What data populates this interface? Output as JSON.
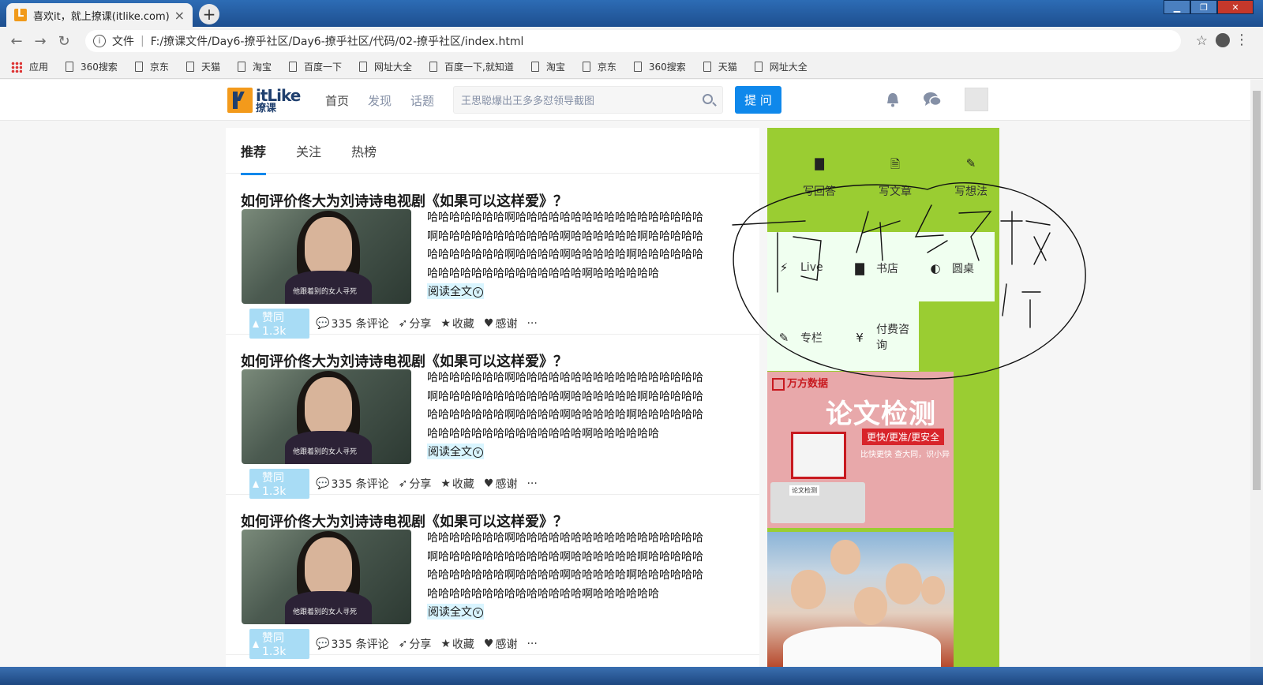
{
  "browser": {
    "tab_title": "喜欢it，就上撩课(itlike.com)",
    "tab_close": "×",
    "new_tab": "+",
    "url_scheme_label": "文件",
    "url": "F:/撩课文件/Day6-撩乎社区/Day6-撩乎社区/代码/02-撩乎社区/index.html",
    "bookmarks": [
      "应用",
      "360搜索",
      "京东",
      "天猫",
      "淘宝",
      "百度一下",
      "网址大全",
      "百度一下,就知道",
      "淘宝",
      "京东",
      "360搜索",
      "天猫",
      "网址大全"
    ]
  },
  "header": {
    "logo_text": "itLike",
    "logo_subtext": "撩课",
    "nav": [
      "首页",
      "发现",
      "话题"
    ],
    "search_placeholder": "王思聪爆出王多多怼领导截图",
    "ask_button": "提 问"
  },
  "feed": {
    "tabs": [
      "推荐",
      "关注",
      "热榜"
    ],
    "items": [
      {
        "title": "如何评价佟大为刘诗诗电视剧《如果可以这样爱》？",
        "excerpt": "哈哈哈哈哈哈哈啊哈哈哈哈哈哈哈哈哈哈哈哈哈哈哈哈哈啊哈哈哈哈哈哈哈哈哈哈哈啊哈哈哈哈哈哈啊哈哈哈哈哈哈哈哈哈哈哈哈啊哈哈哈哈啊哈哈哈哈哈啊哈哈哈哈哈哈哈哈哈哈哈哈哈哈哈哈哈哈哈哈啊哈哈哈哈哈哈",
        "thumb_caption": "他跟着别的女人寻死",
        "read_more": "阅读全文",
        "vote": "赞同 1.3k",
        "comments": "335 条评论",
        "share": "分享",
        "collect": "收藏",
        "thanks": "感谢",
        "more": "···"
      },
      {
        "title": "如何评价佟大为刘诗诗电视剧《如果可以这样爱》？",
        "excerpt": "哈哈哈哈哈哈哈啊哈哈哈哈哈哈哈哈哈哈哈哈哈哈哈哈哈啊哈哈哈哈哈哈哈哈哈哈哈啊哈哈哈哈哈哈啊哈哈哈哈哈哈哈哈哈哈哈哈啊哈哈哈哈啊哈哈哈哈哈啊哈哈哈哈哈哈哈哈哈哈哈哈哈哈哈哈哈哈哈哈啊哈哈哈哈哈哈",
        "thumb_caption": "他跟着别的女人寻死",
        "read_more": "阅读全文",
        "vote": "赞同 1.3k",
        "comments": "335 条评论",
        "share": "分享",
        "collect": "收藏",
        "thanks": "感谢",
        "more": "···"
      },
      {
        "title": "如何评价佟大为刘诗诗电视剧《如果可以这样爱》？",
        "excerpt": "哈哈哈哈哈哈哈啊哈哈哈哈哈哈哈哈哈哈哈哈哈哈哈哈哈啊哈哈哈哈哈哈哈哈哈哈哈啊哈哈哈哈哈哈啊哈哈哈哈哈哈哈哈哈哈哈哈啊哈哈哈哈啊哈哈哈哈哈啊哈哈哈哈哈哈哈哈哈哈哈哈哈哈哈哈哈哈哈哈啊哈哈哈哈哈哈",
        "thumb_caption": "他跟着别的女人寻死",
        "read_more": "阅读全文",
        "vote": "赞同 1.3k",
        "comments": "335 条评论",
        "share": "分享",
        "collect": "收藏",
        "thanks": "感谢",
        "more": "···"
      }
    ]
  },
  "sidebar": {
    "write": [
      "写回答",
      "写文章",
      "写想法"
    ],
    "live": "Live",
    "bookstore": "书店",
    "roundtable": "圆桌",
    "column": "专栏",
    "consult": "付费咨询",
    "ad1_brand": "万方数据",
    "ad1_title": "论文检测",
    "ad1_slogan": "更快/更准/更安全",
    "ad1_sub": "比快更快  查大同，识小异",
    "ad1_search_label": "论文检测"
  },
  "colors": {
    "sidebar_green": "#9acd32",
    "sidebar_light": "#f0fff0",
    "primary_blue": "#0f88eb",
    "vote_bg": "#a8dcf5"
  }
}
